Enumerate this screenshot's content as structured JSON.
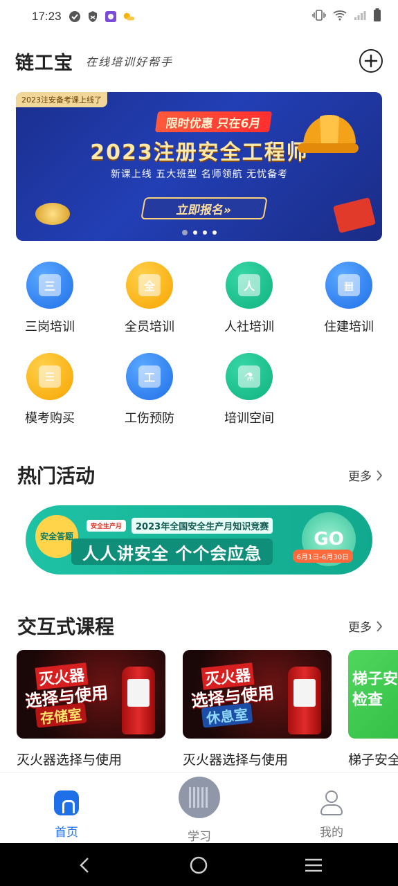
{
  "status_bar": {
    "time": "17:23",
    "battery": "battery-full-icon",
    "icons_left": [
      "check-circle-icon",
      "shield-icon",
      "app-icon",
      "weather-icon"
    ],
    "icons_right": [
      "vibrate-icon",
      "wifi-icon",
      "signal-icon",
      "battery-icon"
    ]
  },
  "header": {
    "brand": "链工宝",
    "slogan": "在线培训好帮手",
    "add_icon": "plus-circle-icon"
  },
  "banner": {
    "tag": "2023注安备考课上线了",
    "promo": "限时优惠 只在6月",
    "title": "2023注册安全工程师",
    "subtitle": "新课上线 五大班型 名师领航 无忧备考",
    "cta": "立即报名»",
    "dots": 4,
    "active_dot": 0
  },
  "features": [
    {
      "label": "三岗培训",
      "icon": "document-icon",
      "glyph": "三",
      "color": "blue"
    },
    {
      "label": "全员培训",
      "icon": "all-staff-icon",
      "glyph": "全",
      "color": "orange"
    },
    {
      "label": "人社培训",
      "icon": "person-icon",
      "glyph": "人",
      "color": "green"
    },
    {
      "label": "住建培训",
      "icon": "building-icon",
      "glyph": "▦",
      "color": "blue"
    },
    {
      "label": "模考购买",
      "icon": "shopping-bag-icon",
      "glyph": "☰",
      "color": "orange"
    },
    {
      "label": "工伤预防",
      "icon": "workbook-icon",
      "glyph": "工",
      "color": "blue"
    },
    {
      "label": "培训空间",
      "icon": "flask-icon",
      "glyph": "⚗",
      "color": "green"
    }
  ],
  "hot_activities": {
    "title": "热门活动",
    "more": "更多",
    "banner": {
      "badge": "安全答题",
      "logo": "安全生产月",
      "contest": "2023年全国安全生产月知识竞赛",
      "slogan": "人人讲安全 个个会应急",
      "go": "GO",
      "dates": "6月1日-6月30日"
    }
  },
  "interactive_courses": {
    "title": "交互式课程",
    "more": "更多",
    "items": [
      {
        "title": "灭火器选择与使用",
        "thumb_line1": "灭火器",
        "thumb_line2": "选择与使用",
        "thumb_line3": "存储室"
      },
      {
        "title": "灭火器选择与使用",
        "thumb_line1": "灭火器",
        "thumb_line2": "选择与使用",
        "thumb_line3": "休息室"
      },
      {
        "title": "梯子安全",
        "thumb_line1": "梯子安",
        "thumb_line2": "检查"
      }
    ]
  },
  "bottom_nav": [
    {
      "label": "首页",
      "icon": "home-icon",
      "active": true
    },
    {
      "label": "学习",
      "icon": "study-icon",
      "active": false
    },
    {
      "label": "我的",
      "icon": "profile-icon",
      "active": false
    }
  ],
  "system_nav": [
    "back-icon",
    "home-circle-icon",
    "menu-icon"
  ],
  "colors": {
    "primary": "#1f6fe8",
    "orange": "#f7a400",
    "green": "#0fb27f"
  }
}
